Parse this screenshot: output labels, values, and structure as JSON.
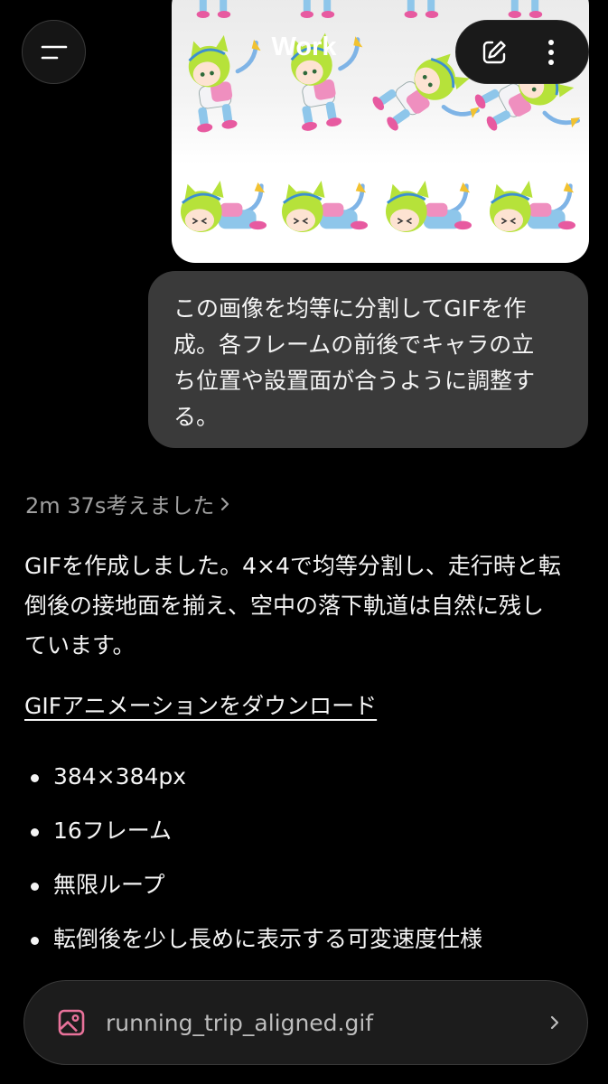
{
  "header": {
    "title": "Work",
    "menu_icon": "hamburger-icon",
    "edit_icon": "edit-icon",
    "more_icon": "more-vertical-icon"
  },
  "attachment": {
    "type": "image",
    "description_icon": "sprite-sheet-image"
  },
  "user_message": {
    "lines": [
      "この画像を均等に分割してGIFを作",
      "成。各フレームの前後でキャラの立",
      "ち位置や設置面が合うように調整す",
      "る。"
    ]
  },
  "assistant": {
    "thought_label": "2m 37s考えました",
    "answer_lines": [
      "GIFを作成しました。4×4で均等分割し、走行時と転",
      "倒後の接地面を揃え、空中の落下軌道は自然に残し",
      "ています。"
    ],
    "download_link": "GIFアニメーションをダウンロード",
    "specs": [
      "384×384px",
      "16フレーム",
      "無限ループ",
      "転倒後を少し長めに表示する可変速度仕様"
    ],
    "file": {
      "name": "running_trip_aligned.gif",
      "icon": "image-file-icon",
      "icon_color": "#e8729a"
    }
  },
  "colors": {
    "background": "#000000",
    "bubble": "#3a3a3a",
    "muted_text": "#a0a0a0",
    "text": "#f4f4f4"
  }
}
